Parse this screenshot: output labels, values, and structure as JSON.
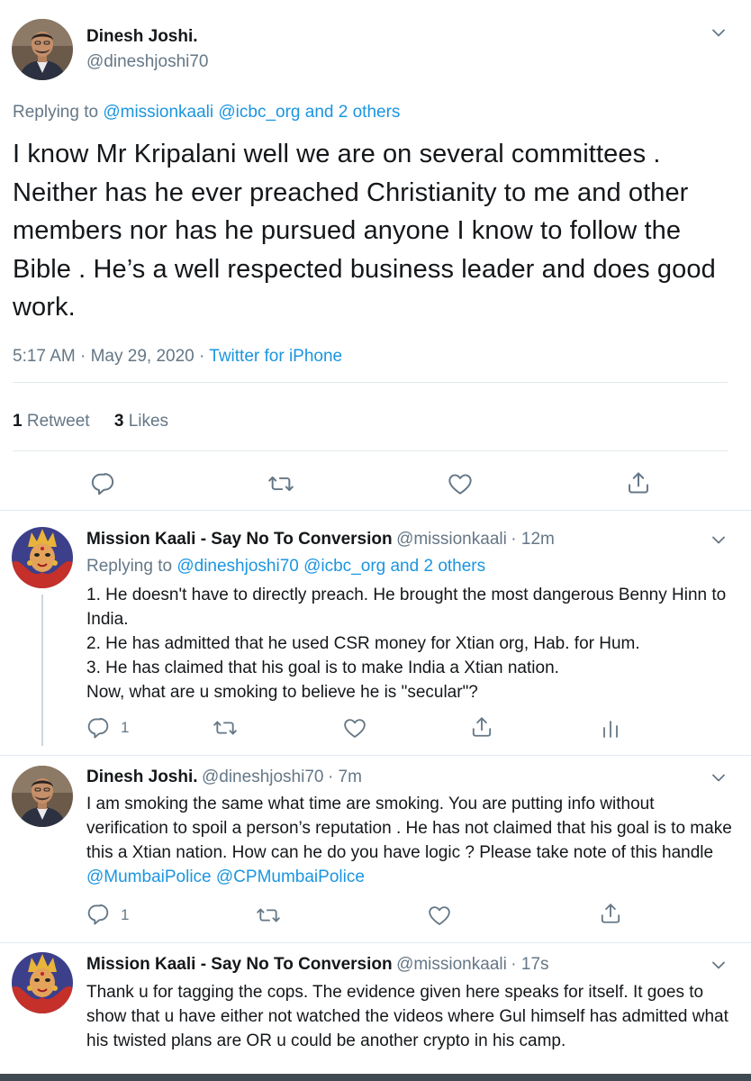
{
  "main_tweet": {
    "author_name": "Dinesh Joshi.",
    "author_handle": "@dineshjoshi70",
    "replying_prefix": "Replying to",
    "replying_to": "@missionkaali @icbc_org and 2 others",
    "text": "I know Mr Kripalani well we are on several committees . Neither has he ever preached Christianity to me and other members nor has he pursued anyone I know to follow the Bible . He’s a well respected business leader and does good work.",
    "time": "5:17 AM · May 29, 2020 ·",
    "source": "Twitter for iPhone",
    "retweets_count": "1",
    "retweets_label": "Retweet",
    "likes_count": "3",
    "likes_label": "Likes"
  },
  "replies": [
    {
      "author_name": "Mission Kaali - Say No To Conversion",
      "author_handle": "@missionkaali",
      "time": "· 12m",
      "replying_prefix": "Replying to",
      "replying_to": "@dineshjoshi70 @icbc_org and 2 others",
      "lines": [
        "1. He doesn't have to directly preach. He brought the most dangerous Benny Hinn to India.",
        "2. He has admitted that he used CSR money for Xtian org, Hab. for Hum.",
        "3. He has claimed that his goal is to make India a Xtian nation.",
        "Now, what are u smoking to believe he is \"secular\"?"
      ],
      "reply_count": "1"
    },
    {
      "author_name": "Dinesh Joshi.",
      "author_handle": "@dineshjoshi70",
      "time": "· 7m",
      "text": "I am smoking the same what time are smoking. You are putting info  without verification to spoil a person’s reputation . He has not claimed that his goal is to make this a Xtian nation. How can he do you have logic ? Please take note of this handle",
      "mentions": "@MumbaiPolice @CPMumbaiPolice",
      "reply_count": "1"
    },
    {
      "author_name": "Mission Kaali - Say No To Conversion",
      "author_handle": "@missionkaali",
      "time": "· 17s",
      "text": "Thank u for tagging the cops. The evidence given here speaks for itself. It goes to show that u have either not watched the videos where Gul himself has admitted what his  twisted plans are OR u could be another crypto in his camp."
    }
  ],
  "icons": [
    "reply-icon",
    "retweet-icon",
    "like-icon",
    "share-icon",
    "analytics-icon",
    "chevron-down-icon"
  ],
  "colors": {
    "link": "#1b95e0",
    "secondary": "#657786",
    "divider": "#e1e8ed"
  }
}
